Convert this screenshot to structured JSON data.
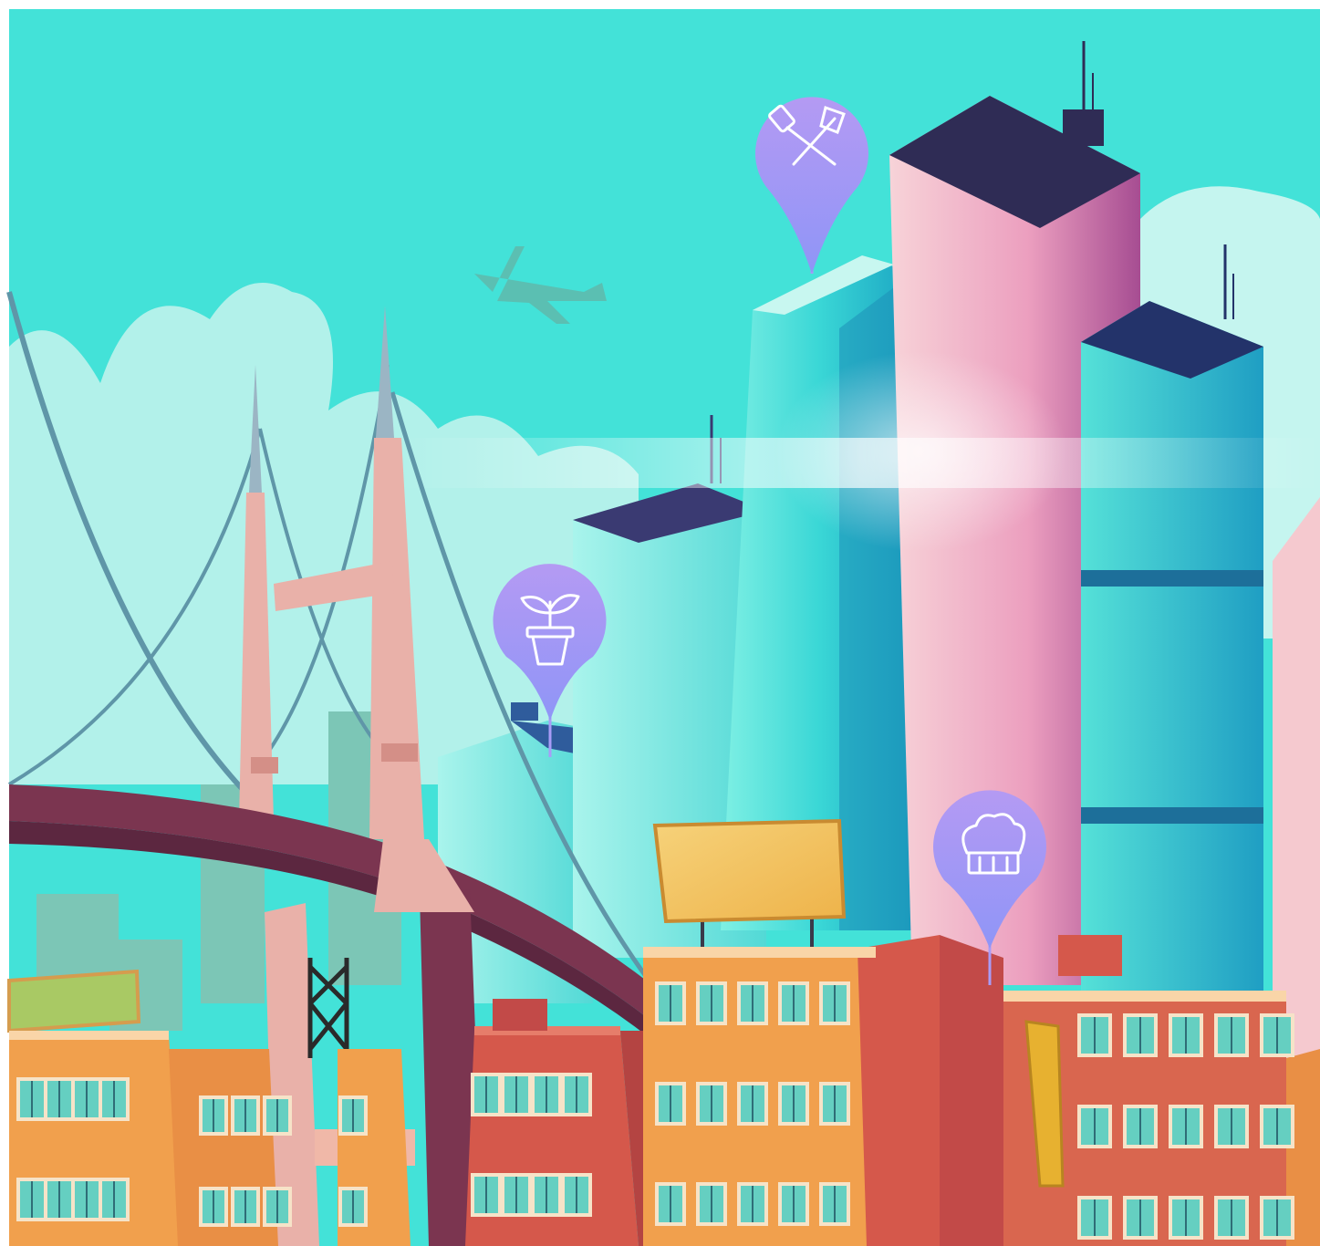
{
  "scene": {
    "colors": {
      "sky": "#43e2d8",
      "cloud": "#bff3ec",
      "cloud_far": "#d4f7f2",
      "skyline_far": "#7cc6b6",
      "bridge_tower": "#e9b1a9",
      "bridge_deck": "#7b3550",
      "cable": "#5f96a8",
      "tower_teal": "#2fc5cf",
      "tower_pink": "#e98fb1",
      "tower_roof": "#2f2c55",
      "brick_orange": "#f1a04d",
      "brick_red": "#d5584b",
      "window": "#65cfc1",
      "billboard": "#f2c457",
      "pin": "#a99cf7"
    },
    "pins": [
      {
        "icon": "tools-icon"
      },
      {
        "icon": "plant-icon"
      },
      {
        "icon": "chef-hat-icon"
      }
    ]
  }
}
